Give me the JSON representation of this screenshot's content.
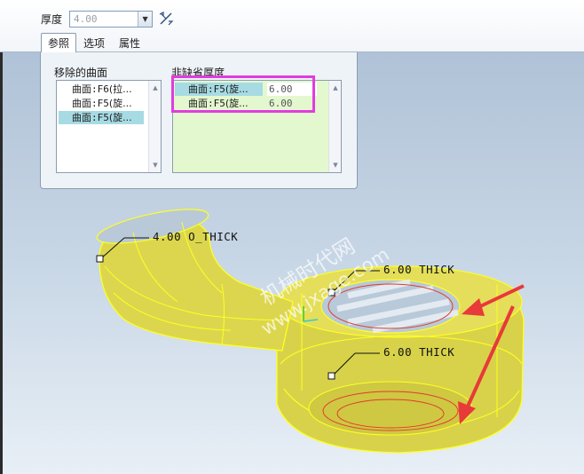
{
  "toolbar": {
    "thickness_label": "厚度",
    "thickness_value": "4.00"
  },
  "tabs": [
    {
      "label": "参照",
      "active": true
    },
    {
      "label": "选项",
      "active": false
    },
    {
      "label": "属性",
      "active": false
    }
  ],
  "removed_surfaces": {
    "title": "移除的曲面",
    "items": [
      {
        "prefix": "曲面",
        "ref": ":F6",
        "name": "(拉..."
      },
      {
        "prefix": "曲面",
        "ref": ":F5",
        "name": "(旋..."
      },
      {
        "prefix": "曲面",
        "ref": ":F5",
        "name": "(旋...",
        "selected": true
      }
    ]
  },
  "non_default_thickness": {
    "title": "非缺省厚度",
    "rows": [
      {
        "prefix": "曲面",
        "ref": ":F5",
        "name": "(旋...",
        "value": "6.00",
        "selected": true
      },
      {
        "prefix": "曲面",
        "ref": ":F5",
        "name": "(旋...",
        "value": "6.00",
        "selected": false
      }
    ]
  },
  "model": {
    "callouts": [
      "4.00 O_THICK",
      "6.00 THICK",
      "6.00 THICK"
    ],
    "watermark_cn": "机械时代网",
    "watermark_url": "www.jxage.com",
    "highlight_color": "#e23be0",
    "arrow_color": "#e83a3a",
    "model_fill": "#d8d24a",
    "edge_color": "#ffff22"
  }
}
